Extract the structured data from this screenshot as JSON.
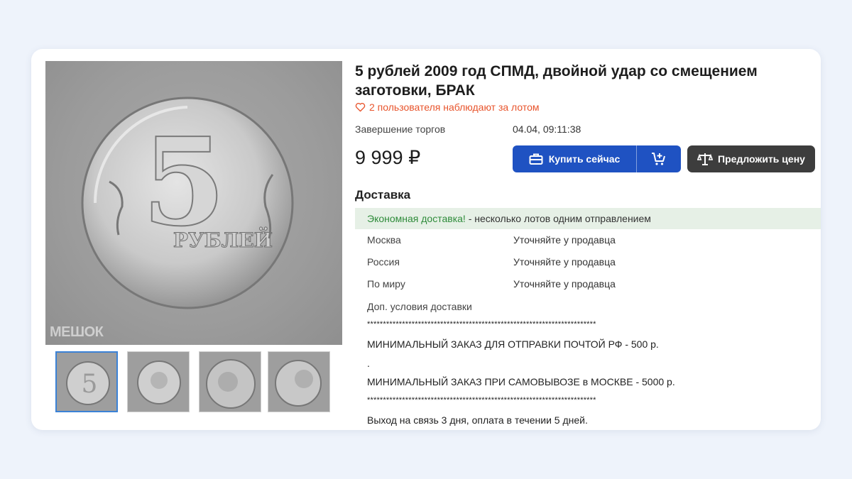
{
  "lot": {
    "title": "5 рублей 2009 год СПМД, двойной удар со смещением заготовки, БРАК",
    "watchers": "2 пользователя наблюдают за лотом",
    "end_label": "Завершение торгов",
    "end_value": "04.04, 09:11:38",
    "price": "9 999 ₽"
  },
  "buttons": {
    "buy_now": "Купить сейчас",
    "make_offer": "Предложить цену"
  },
  "gallery": {
    "watermark": "МЕШОК",
    "thumbnails": [
      "photo-1",
      "photo-2",
      "photo-3",
      "photo-4"
    ],
    "active_index": 0
  },
  "delivery": {
    "heading": "Доставка",
    "economy_highlight": "Экономная доставка!",
    "economy_text": " - несколько лотов одним отправлением",
    "rows": [
      {
        "region": "Москва",
        "value": "Уточняйте у продавца"
      },
      {
        "region": "Россия",
        "value": "Уточняйте у продавца"
      },
      {
        "region": "По миру",
        "value": "Уточняйте у продавца"
      }
    ],
    "extra_label": "Доп. условия доставки",
    "stars": "************************************************************************",
    "min_post": "МИНИМАЛЬНЫЙ ЗАКАЗ ДЛЯ ОТПРАВКИ ПОЧТОЙ РФ - 500 р.",
    "dot": ".",
    "min_pickup": "МИНИМАЛЬНЫЙ ЗАКАЗ ПРИ САМОВЫВОЗЕ в МОСКВЕ - 5000 р.",
    "contact": "Выход на связь 3 дня, оплата в течении 5 дней."
  },
  "colors": {
    "accent": "#1f52c2",
    "watch": "#e8542c",
    "economy": "#2e8b3a",
    "economy_bg": "#e6f0e6"
  }
}
